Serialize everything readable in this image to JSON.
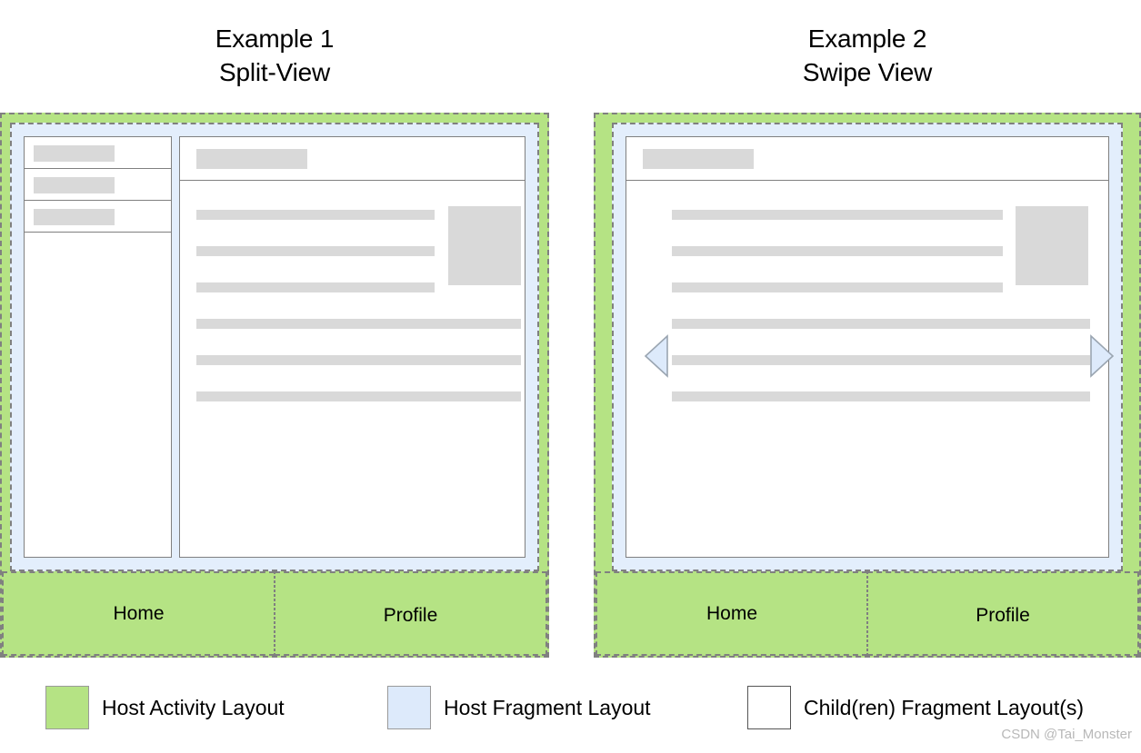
{
  "page": {
    "background_color": "#ffffff",
    "watermark": "CSDN @Tai_Monster"
  },
  "colors": {
    "host_activity_green": "#b5e384",
    "host_fragment_blue": "#e3eefc",
    "child_fragment_white": "#ffffff",
    "skeleton_gray": "#d9d9d9",
    "border_gray": "#808080",
    "arrow_fill": "#ddeafb"
  },
  "examples": [
    {
      "id": "example-1",
      "title_line_1": "Example 1",
      "title_line_2": "Split-View",
      "layout_type": "split-view",
      "panels": [
        {
          "id": "list-panel",
          "kind": "child-fragment",
          "rows": [
            {
              "label": ""
            },
            {
              "label": ""
            },
            {
              "label": ""
            }
          ]
        },
        {
          "id": "detail-panel",
          "kind": "child-fragment",
          "header_placeholder": "",
          "lines": [
            {
              "width": "short"
            },
            {
              "width": "short"
            },
            {
              "width": "short"
            },
            {
              "width": "long"
            },
            {
              "width": "long"
            },
            {
              "width": "long"
            }
          ],
          "image_placeholder": ""
        }
      ],
      "tabs": [
        {
          "label": "Home"
        },
        {
          "label": "Profile"
        }
      ]
    },
    {
      "id": "example-2",
      "title_line_1": "Example 2",
      "title_line_2": "Swipe View",
      "layout_type": "swipe-view",
      "panels": [
        {
          "id": "detail-panel",
          "kind": "child-fragment",
          "header_placeholder": "",
          "lines": [
            {
              "width": "short"
            },
            {
              "width": "short"
            },
            {
              "width": "short"
            },
            {
              "width": "long"
            },
            {
              "width": "long"
            },
            {
              "width": "long"
            }
          ],
          "image_placeholder": ""
        }
      ],
      "arrows": {
        "left": "swipe-left-arrow",
        "right": "swipe-right-arrow"
      },
      "tabs": [
        {
          "label": "Home"
        },
        {
          "label": "Profile"
        }
      ]
    }
  ],
  "legend": {
    "items": [
      {
        "label": "Host Activity Layout",
        "swatch": "sw-green"
      },
      {
        "label": "Host Fragment Layout",
        "swatch": "sw-blue"
      },
      {
        "label": "Child(ren) Fragment Layout(s)",
        "swatch": "sw-white"
      }
    ]
  }
}
